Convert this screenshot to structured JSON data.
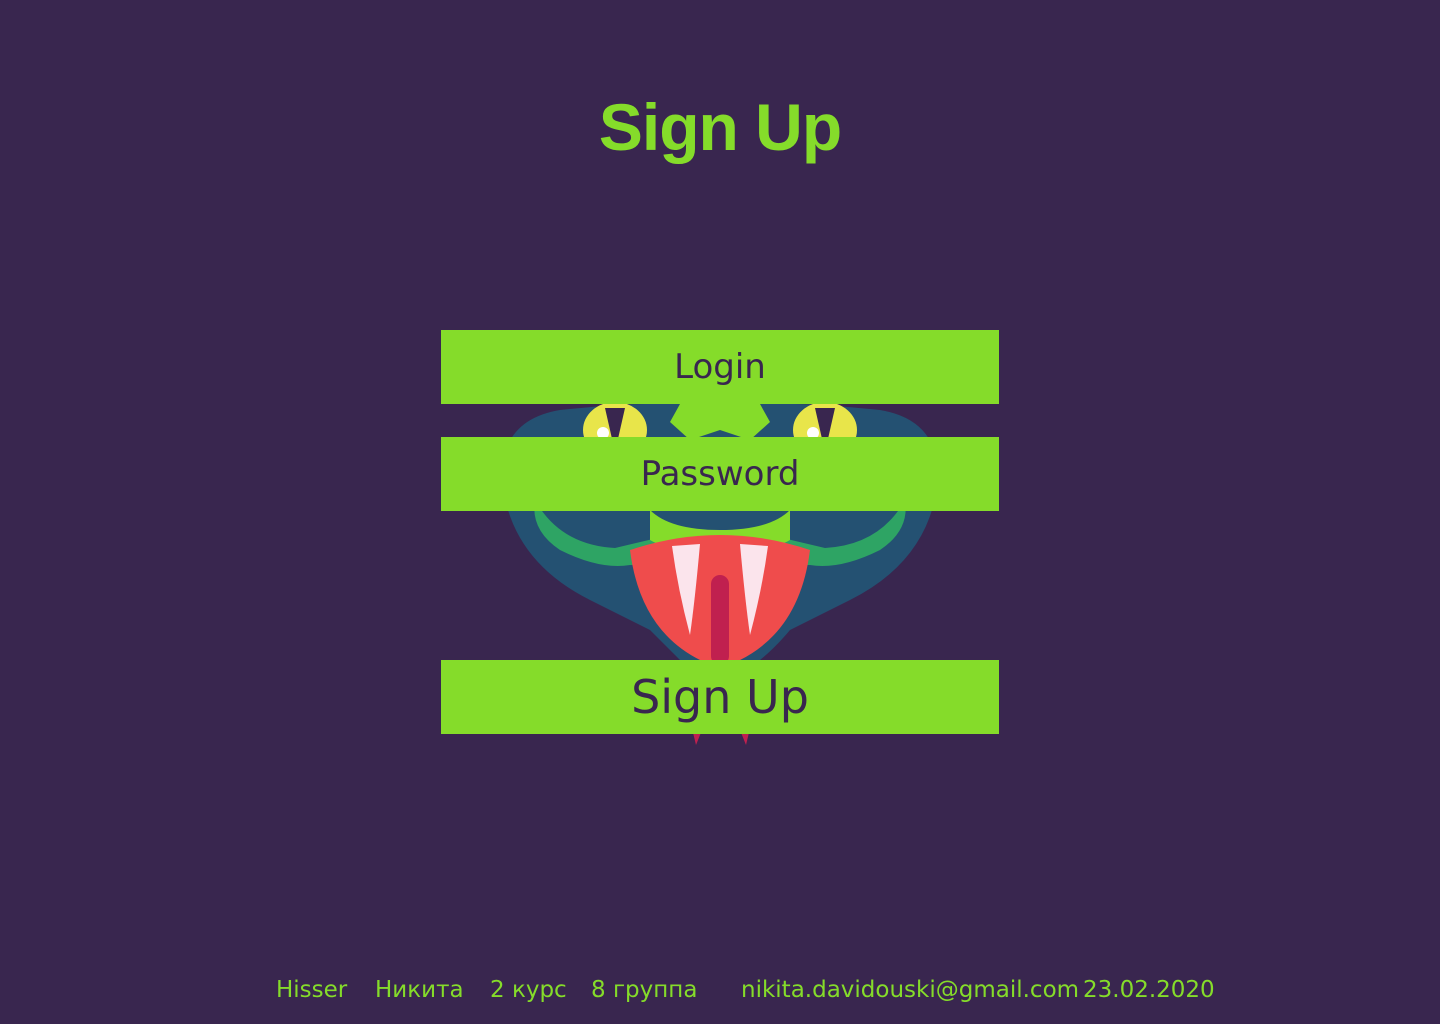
{
  "page": {
    "title": "Sign Up"
  },
  "form": {
    "login_placeholder": "Login",
    "password_placeholder": "Password",
    "submit_label": "Sign Up"
  },
  "illustration": {
    "icon": "snake-head-icon"
  },
  "footer": {
    "brand": "Hisser",
    "name": "Никита",
    "course": "2 курс",
    "group": "8 группа",
    "email": "nikita.davidouski@gmail.com",
    "date": "23.02.2020"
  },
  "colors": {
    "background": "#39264f",
    "accent": "#85dc2a",
    "text_on_accent": "#39264f"
  }
}
